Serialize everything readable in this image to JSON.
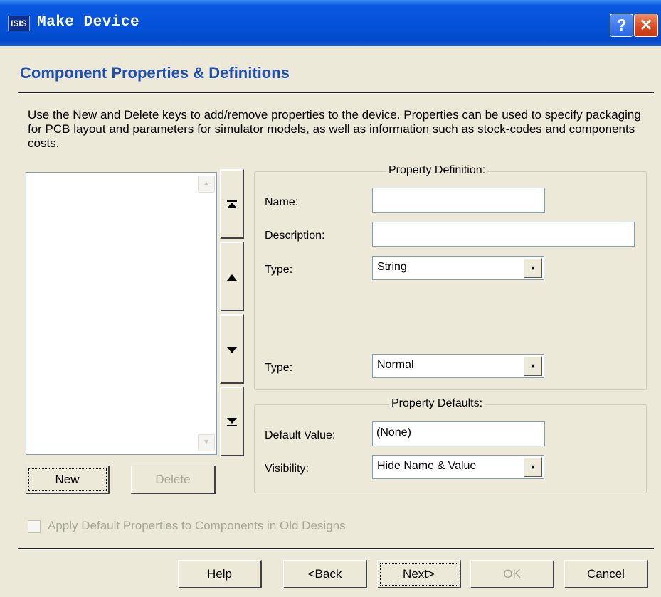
{
  "window": {
    "title": "Make Device",
    "app_icon": "ISIS",
    "help_glyph": "?",
    "close_glyph": "✕"
  },
  "heading": "Component Properties & Definitions",
  "description": "Use the New and Delete keys to add/remove properties to the device. Properties can be used to specify packaging for PCB layout and parameters for simulator models, as well as information such as stock-codes and components costs.",
  "property_list": {
    "items": [],
    "scroll_up_glyph": "▲",
    "scroll_down_glyph": "▼"
  },
  "reorder_buttons": [
    {
      "name": "move-top",
      "icon": "move-top-icon",
      "glyph": "⏶"
    },
    {
      "name": "move-up",
      "icon": "move-up-icon",
      "glyph": "▲"
    },
    {
      "name": "move-down",
      "icon": "move-down-icon",
      "glyph": "▼"
    },
    {
      "name": "move-bottom",
      "icon": "move-bottom-icon",
      "glyph": "⏷"
    }
  ],
  "list_buttons": {
    "new": "New",
    "delete": "Delete"
  },
  "property_definition": {
    "legend": "Property Definition:",
    "name_label": "Name:",
    "name_value": "",
    "description_label": "Description:",
    "description_value": "",
    "type_label": "Type:",
    "type_value": "String",
    "type2_label": "Type:",
    "type2_value": "Normal"
  },
  "property_defaults": {
    "legend": "Property Defaults:",
    "default_value_label": "Default Value:",
    "default_value": "(None)",
    "visibility_label": "Visibility:",
    "visibility_value": "Hide Name & Value"
  },
  "apply_checkbox": {
    "label": "Apply Default Properties to Components in Old Designs",
    "checked": false,
    "enabled": false
  },
  "footer_buttons": {
    "help": "Help",
    "back": "<Back",
    "next": "Next>",
    "ok": "OK",
    "cancel": "Cancel"
  },
  "colors": {
    "dialog_bg": "#ece9d8",
    "titlebar_blue": "#0451d8",
    "heading_blue": "#1f4fb0",
    "disabled_text": "#a6a596"
  }
}
